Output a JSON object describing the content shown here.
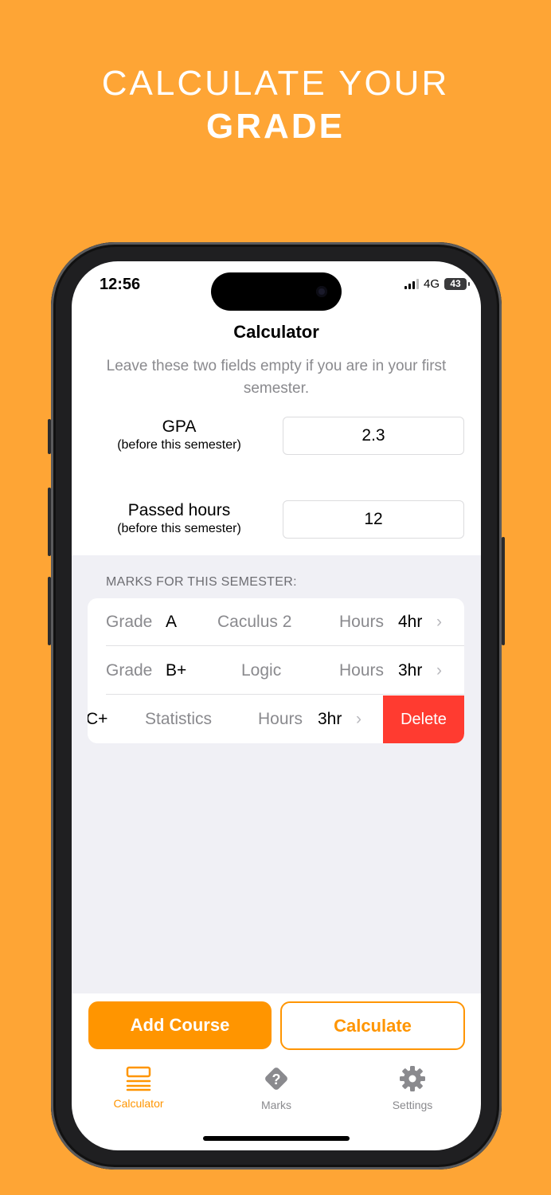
{
  "promo": {
    "line1": "CALCULATE YOUR",
    "line2": "GRADE"
  },
  "status_bar": {
    "time": "12:56",
    "network": "4G",
    "battery": "43"
  },
  "nav": {
    "title": "Calculator"
  },
  "hint": "Leave these two fields empty if you are in your first semester.",
  "gpa": {
    "label": "GPA",
    "sublabel": "(before this semester)",
    "value": "2.3"
  },
  "passed_hours": {
    "label": "Passed hours",
    "sublabel": "(before this semester)",
    "value": "12"
  },
  "marks": {
    "header": "MARKS FOR THIS SEMESTER:",
    "grade_label": "Grade",
    "hours_label": "Hours",
    "rows": [
      {
        "grade": "A",
        "course": "Caculus 2",
        "hours": "4hr"
      },
      {
        "grade": "B+",
        "course": "Logic",
        "hours": "3hr"
      },
      {
        "grade": "C+",
        "grade_visible": "C+",
        "course": "Statistics",
        "hours": "3hr",
        "swipe_action": "Delete"
      }
    ]
  },
  "actions": {
    "add": "Add Course",
    "calculate": "Calculate"
  },
  "tabs": [
    {
      "label": "Calculator",
      "icon": "list-icon",
      "active": true
    },
    {
      "label": "Marks",
      "icon": "question-diamond-icon",
      "active": false
    },
    {
      "label": "Settings",
      "icon": "gear-icon",
      "active": false
    }
  ],
  "colors": {
    "accent": "#FF9500",
    "background": "#FEA535",
    "destructive": "#FF3B30"
  }
}
